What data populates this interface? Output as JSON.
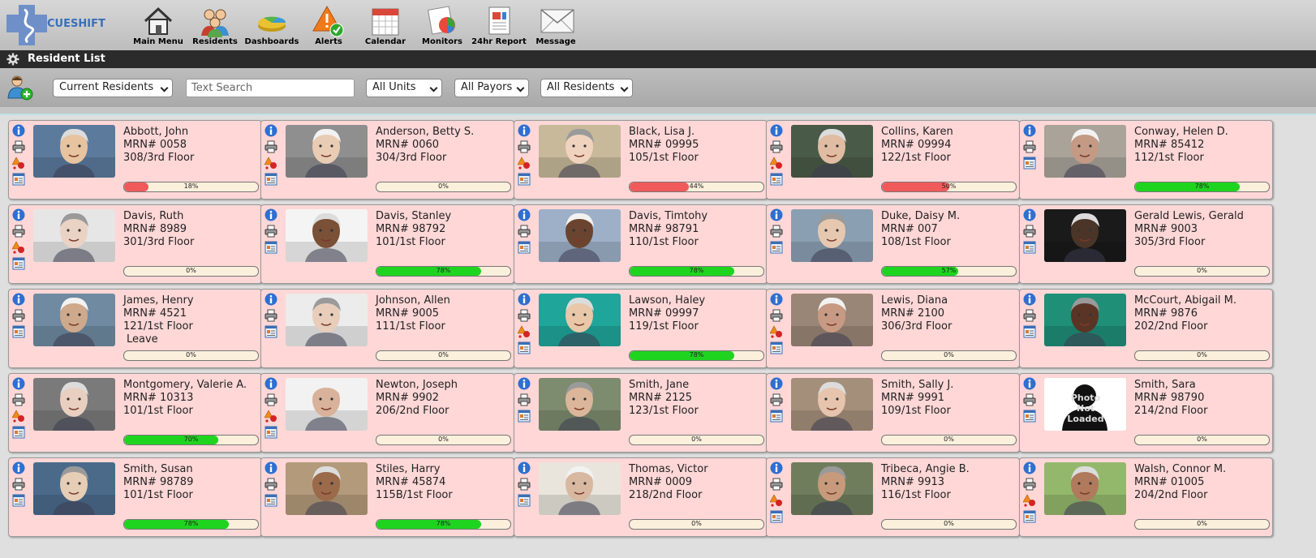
{
  "app": {
    "logo_text_a": "CUE",
    "logo_text_b": "SHIFT"
  },
  "nav": [
    {
      "label": "Main Menu",
      "icon": "house-icon"
    },
    {
      "label": "Residents",
      "icon": "residents-icon"
    },
    {
      "label": "Dashboards",
      "icon": "dashboards-icon"
    },
    {
      "label": "Alerts",
      "icon": "alerts-icon"
    },
    {
      "label": "Calendar",
      "icon": "calendar-icon"
    },
    {
      "label": "Monitors",
      "icon": "monitors-icon"
    },
    {
      "label": "24hr Report",
      "icon": "report-icon"
    },
    {
      "label": "Message",
      "icon": "envelope-icon"
    }
  ],
  "page_title": "Resident List",
  "filters": {
    "status": "Current Residents",
    "search_placeholder": "Text Search",
    "units": "All Units",
    "payors": "All Payors",
    "residents": "All Residents"
  },
  "colors": {
    "bar_red": "#f15a5a",
    "bar_green": "#1fd41f",
    "card_bg": "#ffd7d7"
  },
  "residents": [
    {
      "name": "Abbott, John",
      "mrn": "MRN# 0058",
      "room": "308/3rd Floor",
      "extra": "",
      "pct": 18,
      "pct_label": "18%",
      "color": "red",
      "alert": true,
      "photo": "p1"
    },
    {
      "name": "Anderson, Betty S.",
      "mrn": "MRN# 0060",
      "room": "304/3rd Floor",
      "extra": "",
      "pct": 0,
      "pct_label": "0%",
      "color": "red",
      "alert": true,
      "photo": "p2"
    },
    {
      "name": "Black, Lisa J.",
      "mrn": "MRN# 09995",
      "room": "105/1st Floor",
      "extra": "",
      "pct": 44,
      "pct_label": "44%",
      "color": "red",
      "alert": true,
      "photo": "p3"
    },
    {
      "name": "Collins, Karen",
      "mrn": "MRN# 09994",
      "room": "122/1st Floor",
      "extra": "",
      "pct": 50,
      "pct_label": "50%",
      "color": "red",
      "alert": true,
      "photo": "p4"
    },
    {
      "name": "Conway, Helen D.",
      "mrn": "MRN# 85412",
      "room": "112/1st Floor",
      "extra": "",
      "pct": 78,
      "pct_label": "78%",
      "color": "green",
      "alert": false,
      "photo": "p5"
    },
    {
      "name": "Davis, Ruth",
      "mrn": "MRN# 8989",
      "room": "301/3rd Floor",
      "extra": "",
      "pct": 0,
      "pct_label": "0%",
      "color": "red",
      "alert": true,
      "photo": "p6"
    },
    {
      "name": "Davis, Stanley",
      "mrn": "MRN# 98792",
      "room": "101/1st Floor",
      "extra": "",
      "pct": 78,
      "pct_label": "78%",
      "color": "green",
      "alert": false,
      "photo": "p7"
    },
    {
      "name": "Davis, Timtohy",
      "mrn": "MRN# 98791",
      "room": "110/1st Floor",
      "extra": "",
      "pct": 78,
      "pct_label": "78%",
      "color": "green",
      "alert": false,
      "photo": "p8"
    },
    {
      "name": "Duke, Daisy M.",
      "mrn": "MRN# 007",
      "room": "108/1st Floor",
      "extra": "",
      "pct": 57,
      "pct_label": "57%",
      "color": "green",
      "alert": false,
      "photo": "p9"
    },
    {
      "name": "Gerald Lewis, Gerald",
      "mrn": "MRN# 9003",
      "room": "305/3rd Floor",
      "extra": "",
      "pct": 0,
      "pct_label": "0%",
      "color": "red",
      "alert": false,
      "photo": "p10"
    },
    {
      "name": "James, Henry",
      "mrn": "MRN# 4521",
      "room": "121/1st Floor",
      "extra": "Leave",
      "pct": 0,
      "pct_label": "0%",
      "color": "red",
      "alert": false,
      "photo": "p11"
    },
    {
      "name": "Johnson, Allen",
      "mrn": "MRN# 9005",
      "room": "111/1st Floor",
      "extra": "",
      "pct": 0,
      "pct_label": "0%",
      "color": "red",
      "alert": false,
      "photo": "p12"
    },
    {
      "name": "Lawson, Haley",
      "mrn": "MRN# 09997",
      "room": "119/1st Floor",
      "extra": "",
      "pct": 78,
      "pct_label": "78%",
      "color": "green",
      "alert": true,
      "photo": "p13"
    },
    {
      "name": "Lewis, Diana",
      "mrn": "MRN# 2100",
      "room": "306/3rd Floor",
      "extra": "",
      "pct": 0,
      "pct_label": "0%",
      "color": "red",
      "alert": true,
      "photo": "p14"
    },
    {
      "name": "McCourt, Abigail M.",
      "mrn": "MRN# 9876",
      "room": "202/2nd Floor",
      "extra": "",
      "pct": 0,
      "pct_label": "0%",
      "color": "red",
      "alert": false,
      "photo": "p15"
    },
    {
      "name": "Montgomery, Valerie A.",
      "mrn": "MRN# 10313",
      "room": "101/1st Floor",
      "extra": "",
      "pct": 70,
      "pct_label": "70%",
      "color": "green",
      "alert": true,
      "photo": "p16"
    },
    {
      "name": "Newton, Joseph",
      "mrn": "MRN# 9902",
      "room": "206/2nd Floor",
      "extra": "",
      "pct": 0,
      "pct_label": "0%",
      "color": "red",
      "alert": true,
      "photo": "p17"
    },
    {
      "name": "Smith, Jane",
      "mrn": "MRN# 2125",
      "room": "123/1st Floor",
      "extra": "",
      "pct": 0,
      "pct_label": "0%",
      "color": "red",
      "alert": false,
      "photo": "p18"
    },
    {
      "name": "Smith, Sally J.",
      "mrn": "MRN# 9991",
      "room": "109/1st Floor",
      "extra": "",
      "pct": 0,
      "pct_label": "0%",
      "color": "red",
      "alert": false,
      "photo": "p19"
    },
    {
      "name": "Smith, Sara",
      "mrn": "MRN# 98790",
      "room": "214/2nd Floor",
      "extra": "",
      "pct": 0,
      "pct_label": "0%",
      "color": "red",
      "alert": false,
      "photo": "notloaded",
      "photo_text": "Photo Not Loaded"
    },
    {
      "name": "Smith, Susan",
      "mrn": "MRN# 98789",
      "room": "101/1st Floor",
      "extra": "",
      "pct": 78,
      "pct_label": "78%",
      "color": "green",
      "alert": false,
      "photo": "p21"
    },
    {
      "name": "Stiles, Harry",
      "mrn": "MRN# 45874",
      "room": "115B/1st Floor",
      "extra": "",
      "pct": 78,
      "pct_label": "78%",
      "color": "green",
      "alert": false,
      "photo": "p22"
    },
    {
      "name": "Thomas, Victor",
      "mrn": "MRN# 0009",
      "room": "218/2nd Floor",
      "extra": "",
      "pct": 0,
      "pct_label": "0%",
      "color": "red",
      "alert": false,
      "photo": "p23"
    },
    {
      "name": "Tribeca, Angie B.",
      "mrn": "MRN# 9913",
      "room": "116/1st Floor",
      "extra": "",
      "pct": 0,
      "pct_label": "0%",
      "color": "red",
      "alert": true,
      "photo": "p24"
    },
    {
      "name": "Walsh, Connor M.",
      "mrn": "MRN# 01005",
      "room": "204/2nd Floor",
      "extra": "",
      "pct": 0,
      "pct_label": "0%",
      "color": "red",
      "alert": true,
      "photo": "p25"
    }
  ]
}
